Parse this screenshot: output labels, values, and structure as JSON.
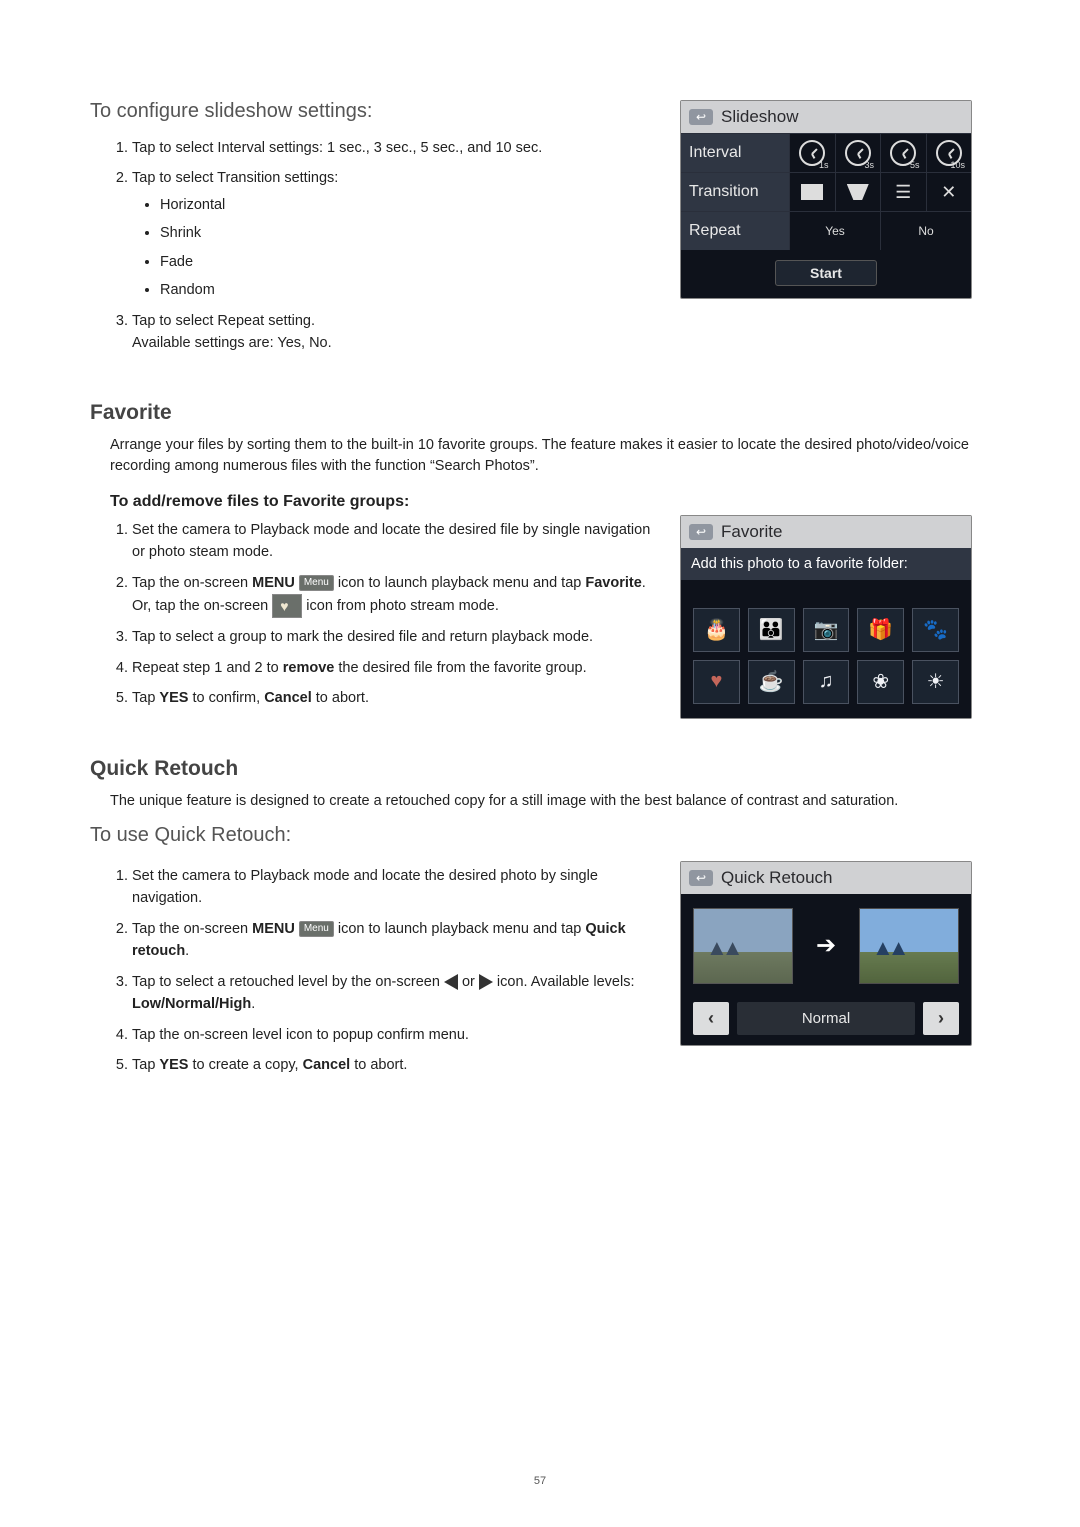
{
  "page_number": "57",
  "slideshow_section": {
    "title": "To configure slideshow settings:",
    "steps": [
      "Tap to select Interval settings: 1 sec., 3 sec., 5 sec., and 10 sec.",
      "Tap to select Transition settings:",
      "Tap to select Repeat setting.\nAvailable settings are: Yes, No."
    ],
    "transition_options": [
      "Horizontal",
      "Shrink",
      "Fade",
      "Random"
    ],
    "lcd": {
      "title": "Slideshow",
      "rows": {
        "interval": {
          "label": "Interval",
          "options": [
            "1s",
            "3s",
            "5s",
            "10s"
          ]
        },
        "transition": {
          "label": "Transition"
        },
        "repeat": {
          "label": "Repeat",
          "options": [
            "Yes",
            "No"
          ]
        }
      },
      "start_label": "Start"
    }
  },
  "favorite_section": {
    "title": "Favorite",
    "intro": "Arrange your files by sorting them to the built-in 10 favorite groups.  The feature makes it easier to locate the desired photo/video/voice recording among numerous files with the function “Search Photos”.",
    "sub_title": "To add/remove files to Favorite groups:",
    "steps": {
      "s1": "Set the camera to Playback mode and locate the desired file by single navigation or photo steam mode.",
      "s2_a": "Tap the on-screen ",
      "s2_menu": "MENU",
      "s2_icon_label": "Menu",
      "s2_b": " icon to launch playback menu and tap ",
      "s2_fav": "Favorite",
      "s2_c": ".",
      "s2_or_a": "Or, tap the on-screen ",
      "s2_or_b": " icon from photo stream mode.",
      "s3": "Tap to select a group to mark the desired file and return playback mode.",
      "s4_a": "Repeat step 1 and 2 to ",
      "s4_bold": "remove",
      "s4_b": " the desired file from the favorite group.",
      "s5_a": "Tap ",
      "s5_yes": "YES",
      "s5_b": " to confirm, ",
      "s5_cancel": "Cancel",
      "s5_c": " to abort."
    },
    "lcd": {
      "title": "Favorite",
      "subtitle": "Add this photo to a favorite folder:",
      "icons": [
        "birthday",
        "family",
        "friends",
        "gift",
        "pets",
        "love",
        "coffee",
        "music",
        "flower",
        "sun"
      ]
    }
  },
  "retouch_section": {
    "title": "Quick Retouch",
    "intro": "The unique feature is designed to create a retouched copy for a still image with the best balance of contrast and saturation.",
    "sub_title": "To use Quick Retouch:",
    "steps": {
      "s1": "Set the camera to Playback mode and locate the desired photo by single navigation.",
      "s2_a": "Tap the on-screen ",
      "s2_menu": "MENU",
      "s2_icon_label": "Menu",
      "s2_b": " icon to launch playback menu and tap ",
      "s2_qr": "Quick retouch",
      "s2_c": ".",
      "s3_a": "Tap to select a retouched level by the on-screen ",
      "s3_or": " or ",
      "s3_b": " icon. Available levels: ",
      "s3_levels": "Low/Normal/High",
      "s3_c": ".",
      "s4": "Tap the on-screen level icon to popup confirm menu.",
      "s5_a": "Tap ",
      "s5_yes": "YES",
      "s5_b": " to create a copy, ",
      "s5_cancel": "Cancel",
      "s5_c": " to abort."
    },
    "lcd": {
      "title": "Quick Retouch",
      "level": "Normal"
    }
  }
}
